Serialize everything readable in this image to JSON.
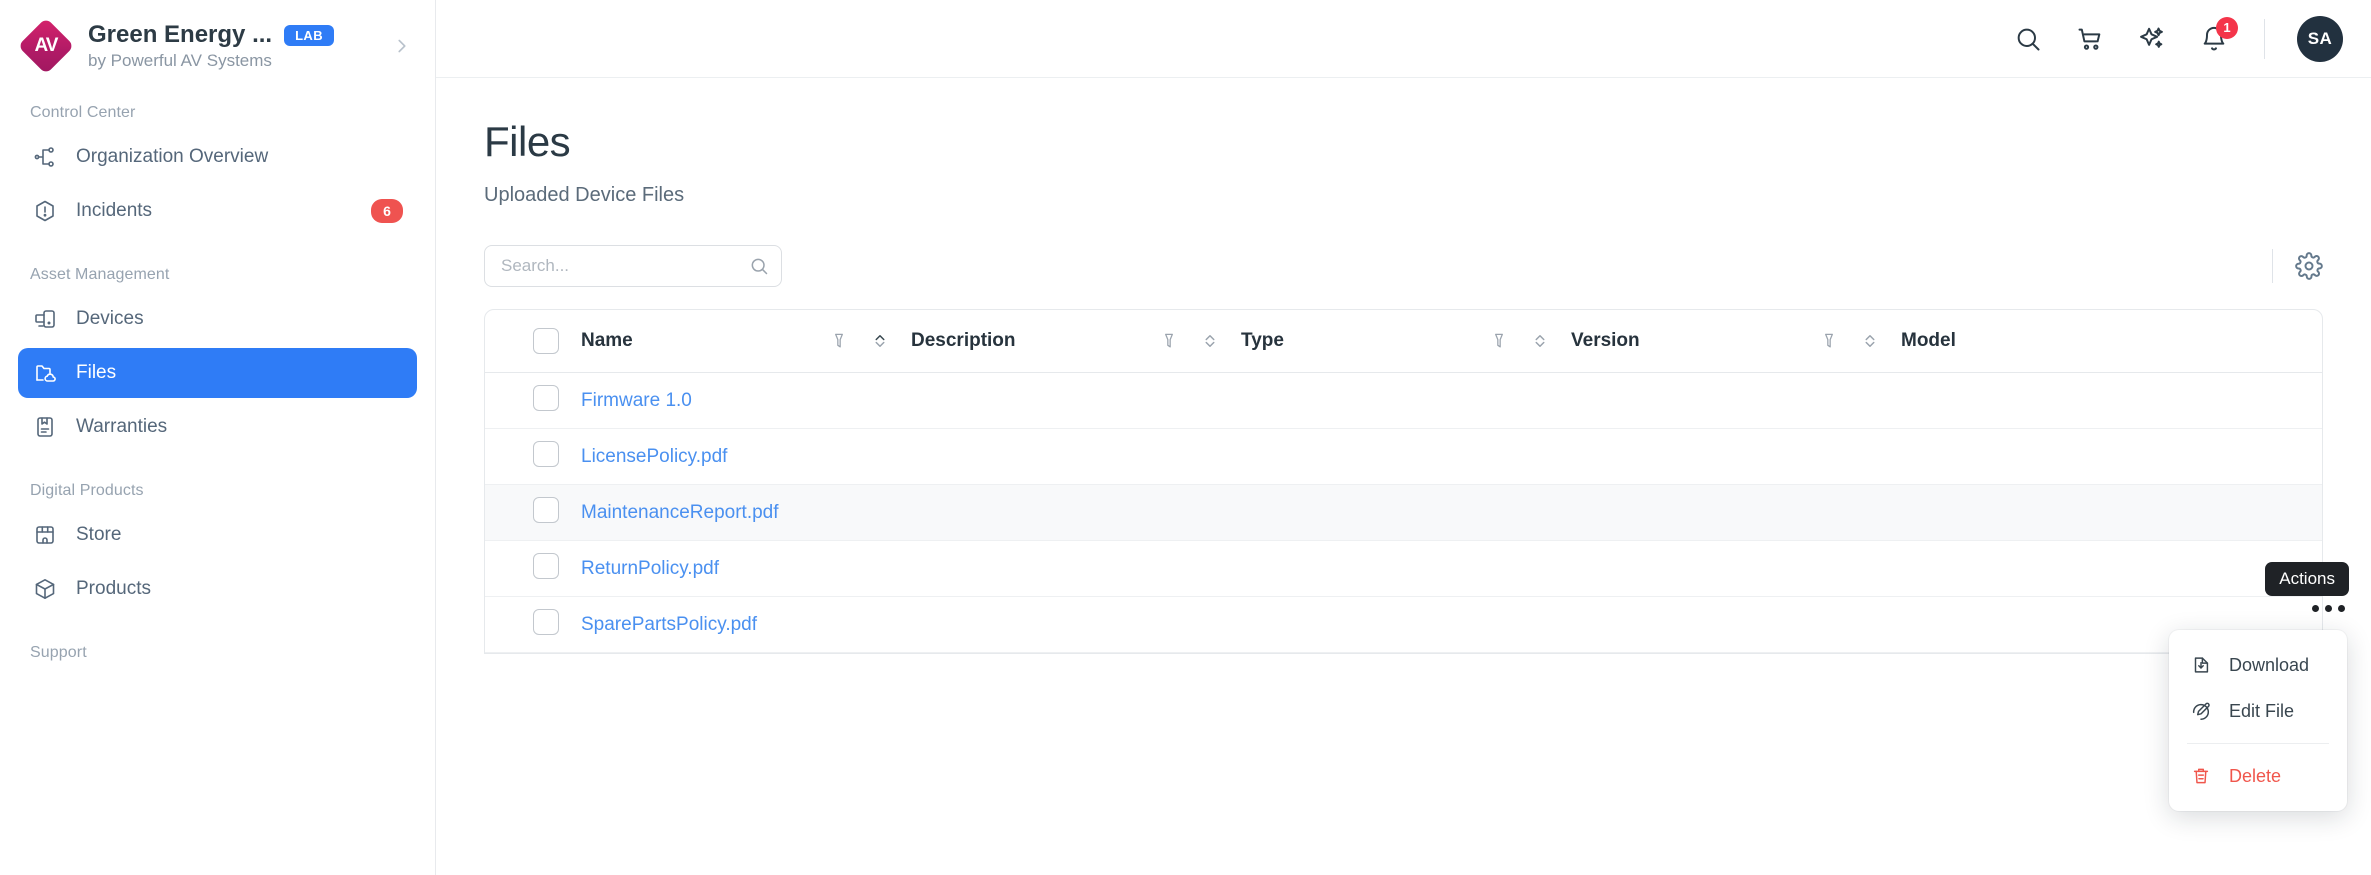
{
  "brand": {
    "title": "Green Energy ...",
    "badge": "LAB",
    "subtitle": "by Powerful AV Systems",
    "logo_initials": "AV",
    "logo_color": "#c21f68",
    "badge_color": "#2f7cf6"
  },
  "sidebar": {
    "sections": [
      {
        "label": "Control Center",
        "items": [
          {
            "label": "Organization Overview",
            "icon": "org-chart-icon",
            "active": false
          },
          {
            "label": "Incidents",
            "icon": "alert-hexagon-icon",
            "active": false,
            "badge": "6"
          }
        ]
      },
      {
        "label": "Asset Management",
        "items": [
          {
            "label": "Devices",
            "icon": "monitor-icon",
            "active": false
          },
          {
            "label": "Files",
            "icon": "folder-cloud-icon",
            "active": true
          },
          {
            "label": "Warranties",
            "icon": "certificate-icon",
            "active": false
          }
        ]
      },
      {
        "label": "Digital Products",
        "items": [
          {
            "label": "Store",
            "icon": "storefront-icon",
            "active": false
          },
          {
            "label": "Products",
            "icon": "box-icon",
            "active": false
          }
        ]
      },
      {
        "label": "Support",
        "items": []
      }
    ]
  },
  "topbar": {
    "icons": [
      "search-icon",
      "shopping-cart-icon",
      "sparkle-ai-icon",
      "notification-bell-icon"
    ],
    "notification_count": "1",
    "avatar_initials": "SA",
    "avatar_color": "#22313f"
  },
  "page": {
    "title": "Files",
    "subtitle": "Uploaded Device Files"
  },
  "search": {
    "placeholder": "Search...",
    "value": ""
  },
  "table": {
    "columns": [
      {
        "label": "Name",
        "filter": true,
        "sort": true
      },
      {
        "label": "Description",
        "filter": true,
        "sort": true
      },
      {
        "label": "Type",
        "filter": true,
        "sort": true
      },
      {
        "label": "Version",
        "filter": true,
        "sort": true
      },
      {
        "label": "Model",
        "filter": false,
        "sort": false
      }
    ],
    "rows": [
      {
        "name": "Firmware 1.0",
        "description": "",
        "type": "",
        "version": "",
        "model": "",
        "highlight": false
      },
      {
        "name": "LicensePolicy.pdf",
        "description": "",
        "type": "",
        "version": "",
        "model": "",
        "highlight": false
      },
      {
        "name": "MaintenanceReport.pdf",
        "description": "",
        "type": "",
        "version": "",
        "model": "",
        "highlight": true
      },
      {
        "name": "ReturnPolicy.pdf",
        "description": "",
        "type": "",
        "version": "",
        "model": "",
        "highlight": false
      },
      {
        "name": "SparePartsPolicy.pdf",
        "description": "",
        "type": "",
        "version": "",
        "model": "",
        "highlight": false
      }
    ],
    "link_color": "#4a90f0"
  },
  "actions": {
    "tooltip": "Actions",
    "menu": [
      {
        "label": "Download",
        "icon": "file-download-icon",
        "danger": false
      },
      {
        "label": "Edit File",
        "icon": "pencil-edit-icon",
        "danger": false
      },
      {
        "label": "Delete",
        "icon": "trash-icon",
        "danger": true
      }
    ],
    "danger_color": "#f0564c"
  }
}
